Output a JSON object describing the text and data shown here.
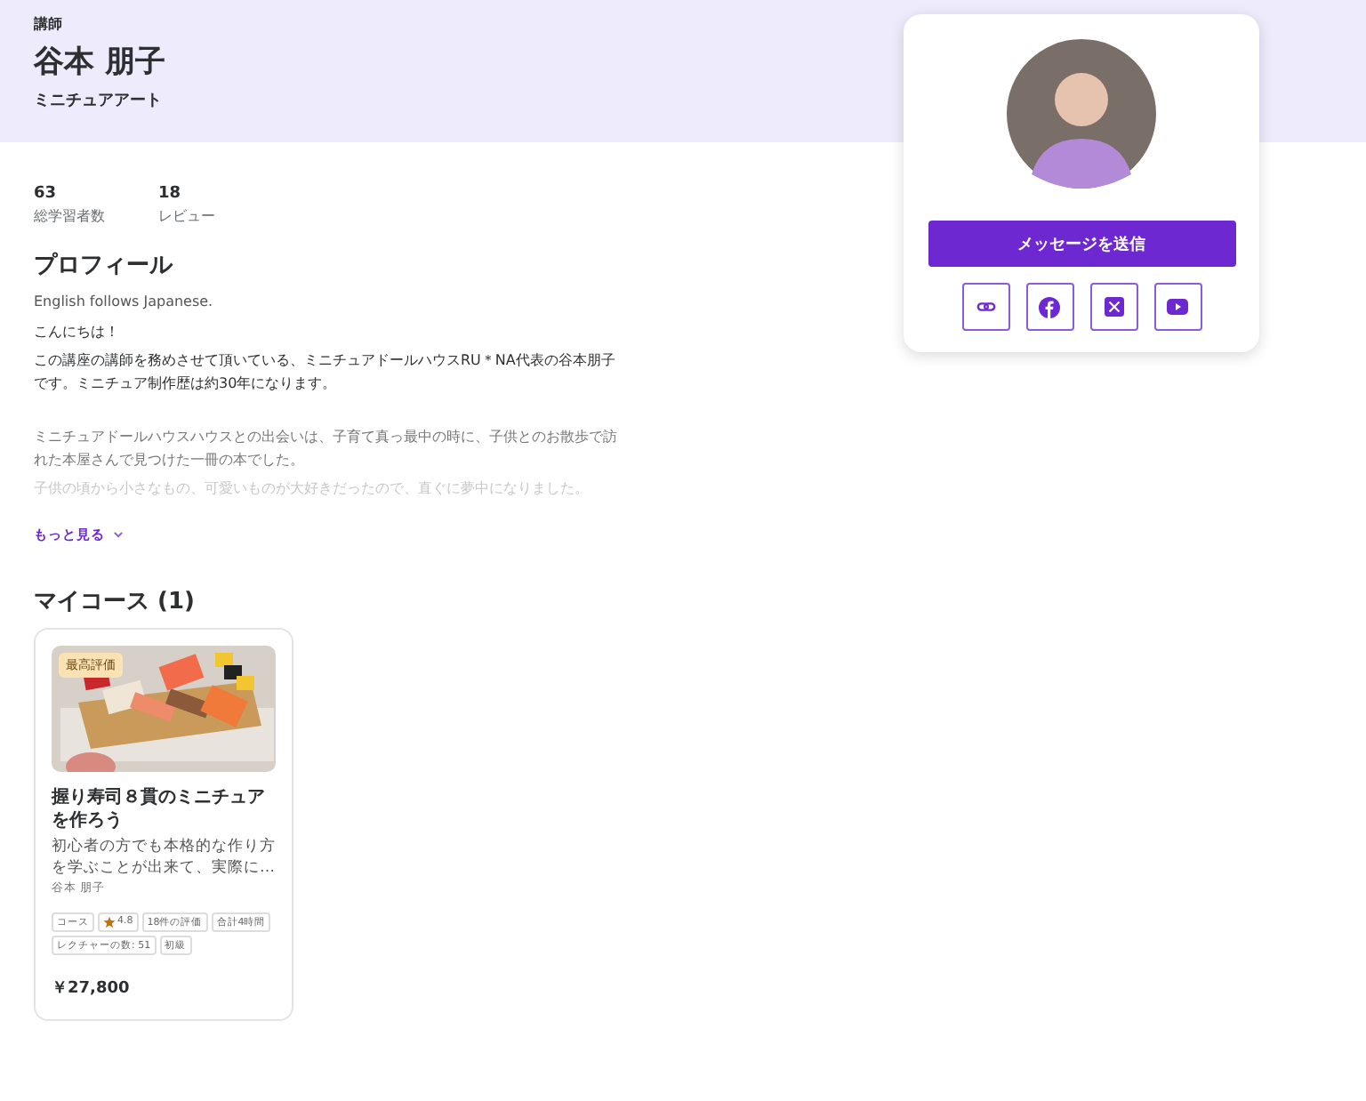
{
  "header": {
    "role": "講師",
    "name": "谷本 朋子",
    "subtitle": "ミニチュアアート"
  },
  "stats": [
    {
      "value": "63",
      "label": "総学習者数"
    },
    {
      "value": "18",
      "label": "レビュー"
    }
  ],
  "profile": {
    "heading": "プロフィール",
    "paragraphs": [
      {
        "kind": "small",
        "text": "English follows Japanese."
      },
      {
        "kind": "normal",
        "text": "こんにちは！"
      },
      {
        "kind": "normal",
        "text": "この講座の講師を務めさせて頂いている、ミニチュアドールハウスRU＊NA代表の谷本朋子です。ミニチュア制作歴は約30年になります。"
      },
      {
        "kind": "spacer-faded",
        "text": "ミニチュアドールハウスハウスとの出会いは、子育て真っ最中の時に、子供とのお散歩で訪れた本屋さんで見つけた一冊の本でした。"
      },
      {
        "kind": "faint",
        "text": "子供の頃から小さなもの、可愛いものが大好きだったので、直ぐに夢中になりました。"
      }
    ],
    "more_link": "もっと見る"
  },
  "courses": {
    "heading": "マイコース (1)",
    "items": [
      {
        "badge": "最高評価",
        "title": "握り寿司８貫のミニチュアを作ろう",
        "description": "初心者の方でも本格的な作り方を学ぶことが出来て、実際に…",
        "instructor": "谷本 朋子",
        "tags": [
          {
            "kind": "plain",
            "text": "コース"
          },
          {
            "kind": "rating",
            "text": "4.8"
          },
          {
            "kind": "plain",
            "text": "18件の評価"
          },
          {
            "kind": "plain",
            "text": "合計4時間"
          },
          {
            "kind": "plain",
            "text": "レクチャーの数: 51"
          },
          {
            "kind": "plain",
            "text": "初級"
          }
        ],
        "price": "￥27,800"
      }
    ]
  },
  "sidebar_card": {
    "message_button": "メッセージを送信",
    "social_links": [
      {
        "kind": "link"
      },
      {
        "kind": "facebook"
      },
      {
        "kind": "x"
      },
      {
        "kind": "youtube"
      }
    ]
  }
}
